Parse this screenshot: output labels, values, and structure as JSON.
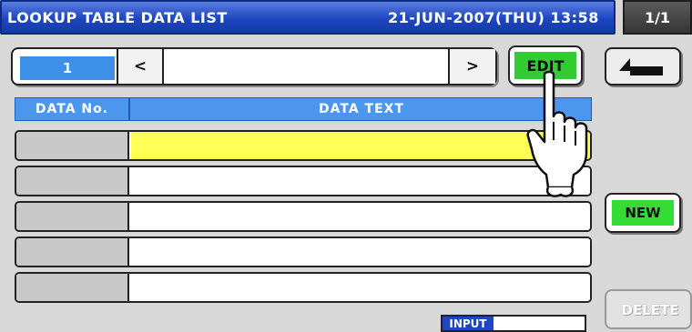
{
  "header": {
    "title": "LOOKUP TABLE DATA LIST",
    "datetime": "21-JUN-2007(THU) 13:58",
    "page_indicator": "1/1"
  },
  "nav": {
    "page_number": "1",
    "prev_label": "<",
    "next_label": ">",
    "field_value": ""
  },
  "buttons": {
    "edit_label": "EDIT",
    "back_icon": "return-arrow-icon",
    "new_label": "NEW",
    "delete_label": "DELETE"
  },
  "table": {
    "columns": [
      "DATA No.",
      "DATA TEXT"
    ],
    "rows": [
      {
        "no": "",
        "text": "",
        "selected": true
      },
      {
        "no": "",
        "text": "",
        "selected": false
      },
      {
        "no": "",
        "text": "",
        "selected": false
      },
      {
        "no": "",
        "text": "",
        "selected": false
      },
      {
        "no": "",
        "text": "",
        "selected": false
      }
    ]
  },
  "status": {
    "input_label": "INPUT",
    "input_value": ""
  },
  "overlay": {
    "pointer_icon": "pointing-hand-icon"
  },
  "colors": {
    "title_blue": "#1d46c0",
    "header_blue": "#4d96ee",
    "selection_yellow": "#ffff55",
    "action_green": "#33cc33"
  }
}
